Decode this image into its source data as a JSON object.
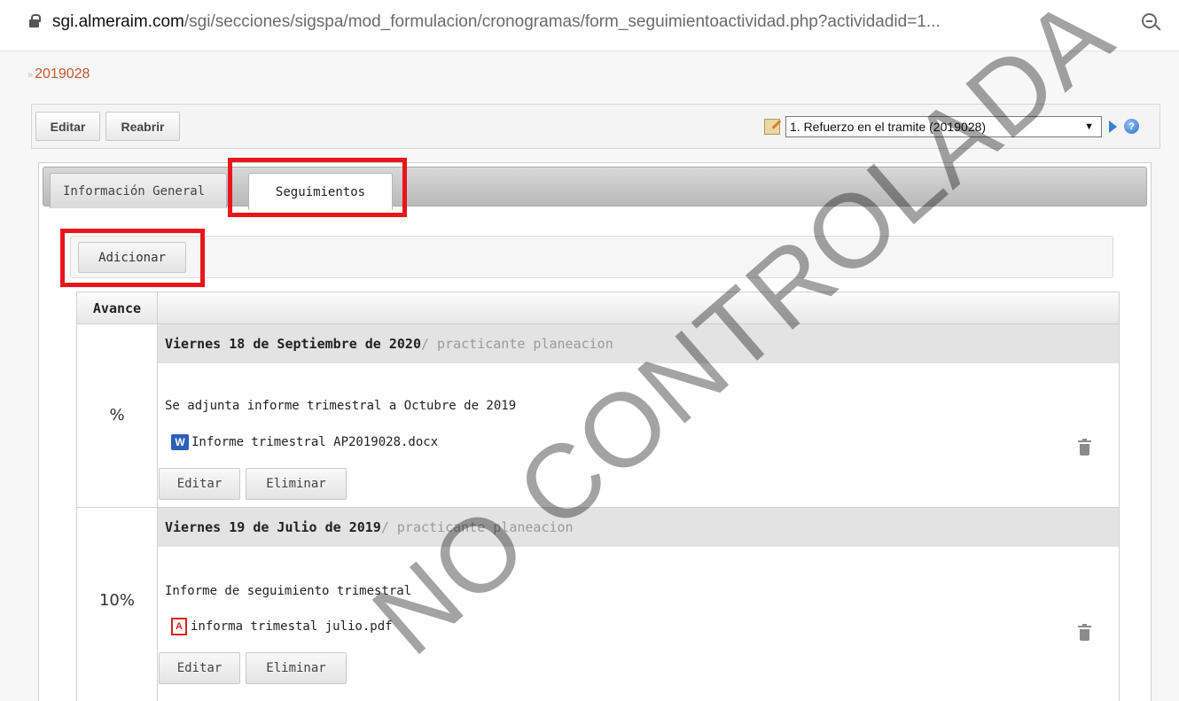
{
  "browser": {
    "url_host": "sgi.almeraim.com",
    "url_path": "/sgi/secciones/sigspa/mod_formulacion/cronogramas/form_seguimientoactividad.php?actividadid=1..."
  },
  "breadcrumb": {
    "label": "2019028"
  },
  "toolbar": {
    "edit_label": "Editar",
    "reopen_label": "Reabrir",
    "activity_select_value": "1. Refuerzo en el tramite (2019028)",
    "help_glyph": "?"
  },
  "tabs": [
    {
      "label": "Información General",
      "selected": false
    },
    {
      "label": "Seguimientos",
      "selected": true
    }
  ],
  "actions": {
    "add_label": "Adicionar"
  },
  "table": {
    "header_avance": "Avance",
    "entries": [
      {
        "date": "Viernes 18 de Septiembre de 2020",
        "user": " / practicante planeacion",
        "avance": "%",
        "description": "Se adjunta informe trimestral a Octubre de 2019",
        "file": "Informe trimestral AP2019028.docx",
        "file_type": "word-icon",
        "edit_label": "Editar",
        "delete_label": "Eliminar"
      },
      {
        "date": "Viernes 19 de Julio de 2019",
        "user": " / practicante planeacion",
        "avance": "10%",
        "description": "Informe de seguimiento trimestral",
        "file": "informa trimestal julio.pdf",
        "file_type": "pdf-icon",
        "edit_label": "Editar",
        "delete_label": "Eliminar"
      }
    ]
  },
  "watermark": {
    "text": "NO CONTROLADA"
  },
  "colors": {
    "breadcrumb": "#c0582c",
    "highlight": "#e8161b",
    "entry_header_bg": "#e3e3e3",
    "user_text": "#9a9a9a"
  }
}
